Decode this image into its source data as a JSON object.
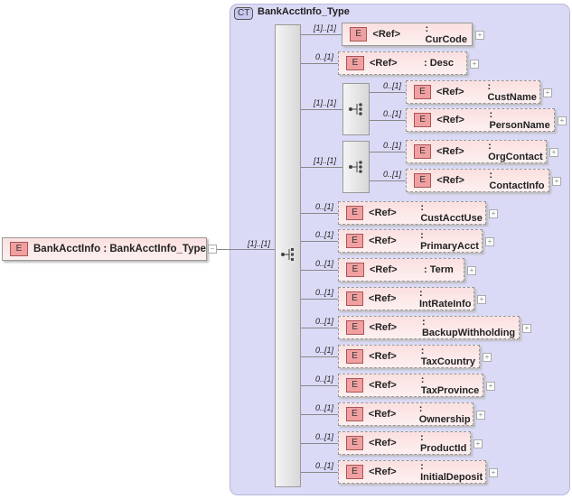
{
  "root": {
    "badge": "E",
    "name": "BankAcctInfo",
    "type": "BankAcctInfo_Type",
    "cardinality": "[1]..[1]"
  },
  "complex_type": {
    "badge": "CT",
    "name": "BankAcctInfo_Type"
  },
  "children": [
    {
      "kind": "element",
      "ref": "<Ref>",
      "name": ": CurCode",
      "card": "[1]..[1]",
      "optional": false
    },
    {
      "kind": "element",
      "ref": "<Ref>",
      "name": ": Desc",
      "card": "0..[1]",
      "optional": true
    },
    {
      "kind": "choice",
      "card": "[1]..[1]",
      "items": [
        {
          "ref": "<Ref>",
          "name": ": CustName",
          "card": "0..[1]"
        },
        {
          "ref": "<Ref>",
          "name": ": PersonName",
          "card": "0..[1]"
        }
      ]
    },
    {
      "kind": "choice",
      "card": "[1]..[1]",
      "items": [
        {
          "ref": "<Ref>",
          "name": ": OrgContact",
          "card": "0..[1]"
        },
        {
          "ref": "<Ref>",
          "name": ": ContactInfo",
          "card": "0..[1]"
        }
      ]
    },
    {
      "kind": "element",
      "ref": "<Ref>",
      "name": ": CustAcctUse",
      "card": "0..[1]",
      "optional": true
    },
    {
      "kind": "element",
      "ref": "<Ref>",
      "name": ": PrimaryAcct",
      "card": "0..[1]",
      "optional": true
    },
    {
      "kind": "element",
      "ref": "<Ref>",
      "name": ": Term",
      "card": "0..[1]",
      "optional": true
    },
    {
      "kind": "element",
      "ref": "<Ref>",
      "name": ": IntRateInfo",
      "card": "0..[1]",
      "optional": true
    },
    {
      "kind": "element",
      "ref": "<Ref>",
      "name": ": BackupWithholding",
      "card": "0..[1]",
      "optional": true
    },
    {
      "kind": "element",
      "ref": "<Ref>",
      "name": ": TaxCountry",
      "card": "0..[1]",
      "optional": true
    },
    {
      "kind": "element",
      "ref": "<Ref>",
      "name": ": TaxProvince",
      "card": "0..[1]",
      "optional": true
    },
    {
      "kind": "element",
      "ref": "<Ref>",
      "name": ": Ownership",
      "card": "0..[1]",
      "optional": true
    },
    {
      "kind": "element",
      "ref": "<Ref>",
      "name": ": ProductId",
      "card": "0..[1]",
      "optional": true
    },
    {
      "kind": "element",
      "ref": "<Ref>",
      "name": ": InitialDeposit",
      "card": "0..[1]",
      "optional": true
    }
  ],
  "element_badge": "E",
  "expand_glyph": "+",
  "collapse_glyph": "−"
}
